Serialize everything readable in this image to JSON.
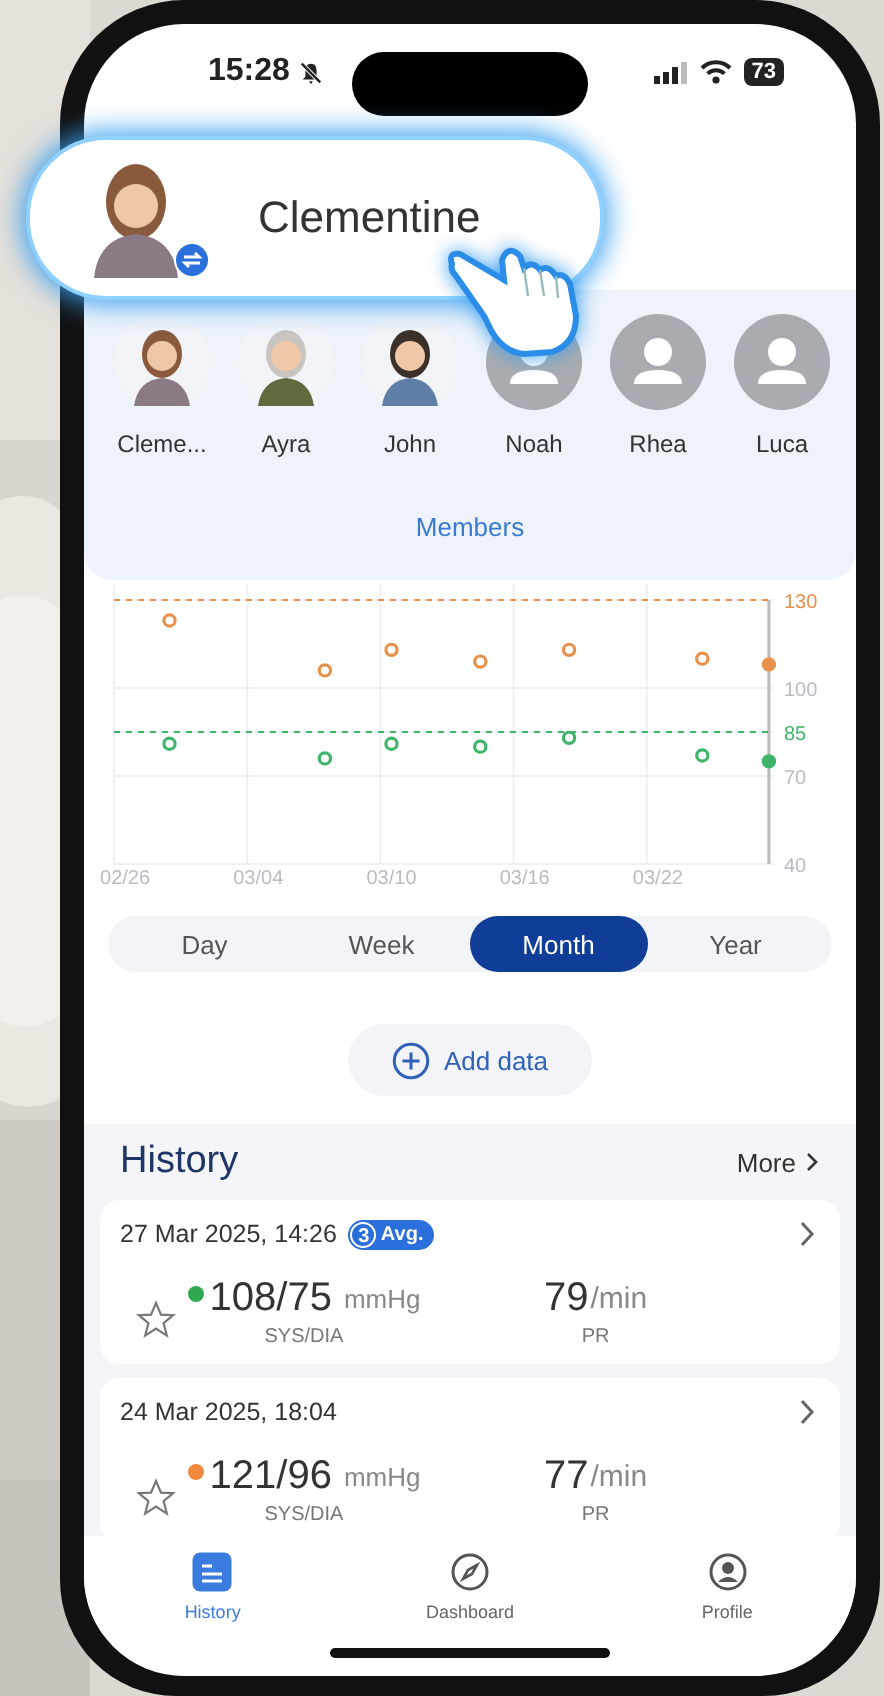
{
  "status_bar": {
    "time": "15:28",
    "battery": "73"
  },
  "current_member": {
    "name": "Clementine"
  },
  "members": [
    {
      "name": "Cleme..."
    },
    {
      "name": "Ayra"
    },
    {
      "name": "John"
    },
    {
      "name": "Noah",
      "kind": "placeholder"
    },
    {
      "name": "Rhea",
      "kind": "placeholder"
    },
    {
      "name": "Luca",
      "kind": "placeholder"
    }
  ],
  "members_link": "Members",
  "chart_data": {
    "type": "scatter",
    "categories": [
      "02/26",
      null,
      null,
      null,
      null,
      null,
      "03/04",
      null,
      null,
      null,
      null,
      null,
      "03/10",
      null,
      null,
      null,
      null,
      null,
      "03/16",
      null,
      null,
      null,
      null,
      null,
      "03/22",
      null,
      null,
      null,
      null,
      null
    ],
    "series": [
      {
        "color": "#e8914a",
        "values": [
          null,
          null,
          123,
          null,
          null,
          null,
          null,
          null,
          null,
          106,
          null,
          null,
          113,
          null,
          null,
          null,
          109,
          null,
          null,
          null,
          113,
          null,
          null,
          null,
          null,
          null,
          110,
          null,
          null,
          108
        ]
      },
      {
        "color": "#3fb56a",
        "values": [
          null,
          null,
          81,
          null,
          null,
          null,
          null,
          null,
          null,
          76,
          null,
          null,
          81,
          null,
          null,
          null,
          80,
          null,
          null,
          null,
          83,
          null,
          null,
          null,
          null,
          null,
          77,
          null,
          null,
          75
        ]
      }
    ],
    "ylim": [
      40,
      130
    ],
    "yticks": [
      40,
      70,
      85,
      100,
      130
    ],
    "grid": true,
    "ref_lines": [
      {
        "axis": "y",
        "value": 130
      },
      {
        "axis": "y",
        "value": 85
      }
    ]
  },
  "periods": [
    {
      "label": "Day",
      "selected": false
    },
    {
      "label": "Week",
      "selected": false
    },
    {
      "label": "Month",
      "selected": true
    },
    {
      "label": "Year",
      "selected": false
    }
  ],
  "add_button": "Add data",
  "history": {
    "title": "History",
    "more": "More",
    "records": [
      {
        "date": "27 Mar 2025, 14:26",
        "badge": {
          "count": "3",
          "label": "Avg."
        },
        "starred": false,
        "color": "#2fa84f",
        "bp": "108/75",
        "bp_unit": "mmHg",
        "bp_label": "SYS/DIA",
        "pulse": "79",
        "pulse_unit": "/min",
        "pulse_label": "PR"
      },
      {
        "date": "24 Mar 2025, 18:04",
        "starred": false,
        "color": "#f08a3c",
        "bp": "121/96",
        "bp_unit": "mmHg",
        "bp_label": "SYS/DIA",
        "pulse": "77",
        "pulse_unit": "/min",
        "pulse_label": "PR"
      }
    ]
  },
  "tabs": [
    {
      "label": "History",
      "kind": "history",
      "selected": true
    },
    {
      "label": "Dashboard",
      "kind": "dashboard",
      "selected": false
    },
    {
      "label": "Profile",
      "kind": "profile",
      "selected": false
    }
  ]
}
